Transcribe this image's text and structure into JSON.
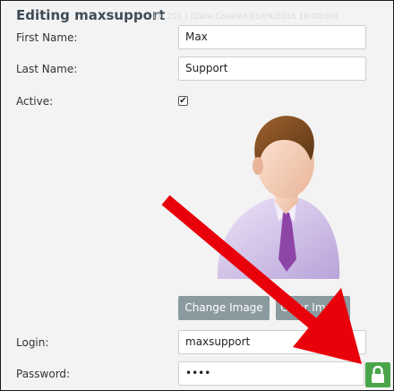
{
  "form": {
    "title": "Editing maxsupport",
    "meta": "ID: 201 | (Date Created 01/09/2018 10:00:00)",
    "first_name_label": "First Name:",
    "first_name_value": "Max",
    "last_name_label": "Last Name:",
    "last_name_value": "Support",
    "active_label": "Active:",
    "active_checked": true,
    "change_image_label": "Change Image",
    "clear_image_label": "Clear Image",
    "login_label": "Login:",
    "login_value": "maxsupport",
    "password_label": "Password:",
    "password_value": "••••"
  },
  "icons": {
    "active_check": "✔",
    "lock": "lock-icon"
  },
  "colors": {
    "annotation_arrow": "#e8000b",
    "lock_button": "#4aa54a",
    "button_bg": "#8b9a9f"
  }
}
